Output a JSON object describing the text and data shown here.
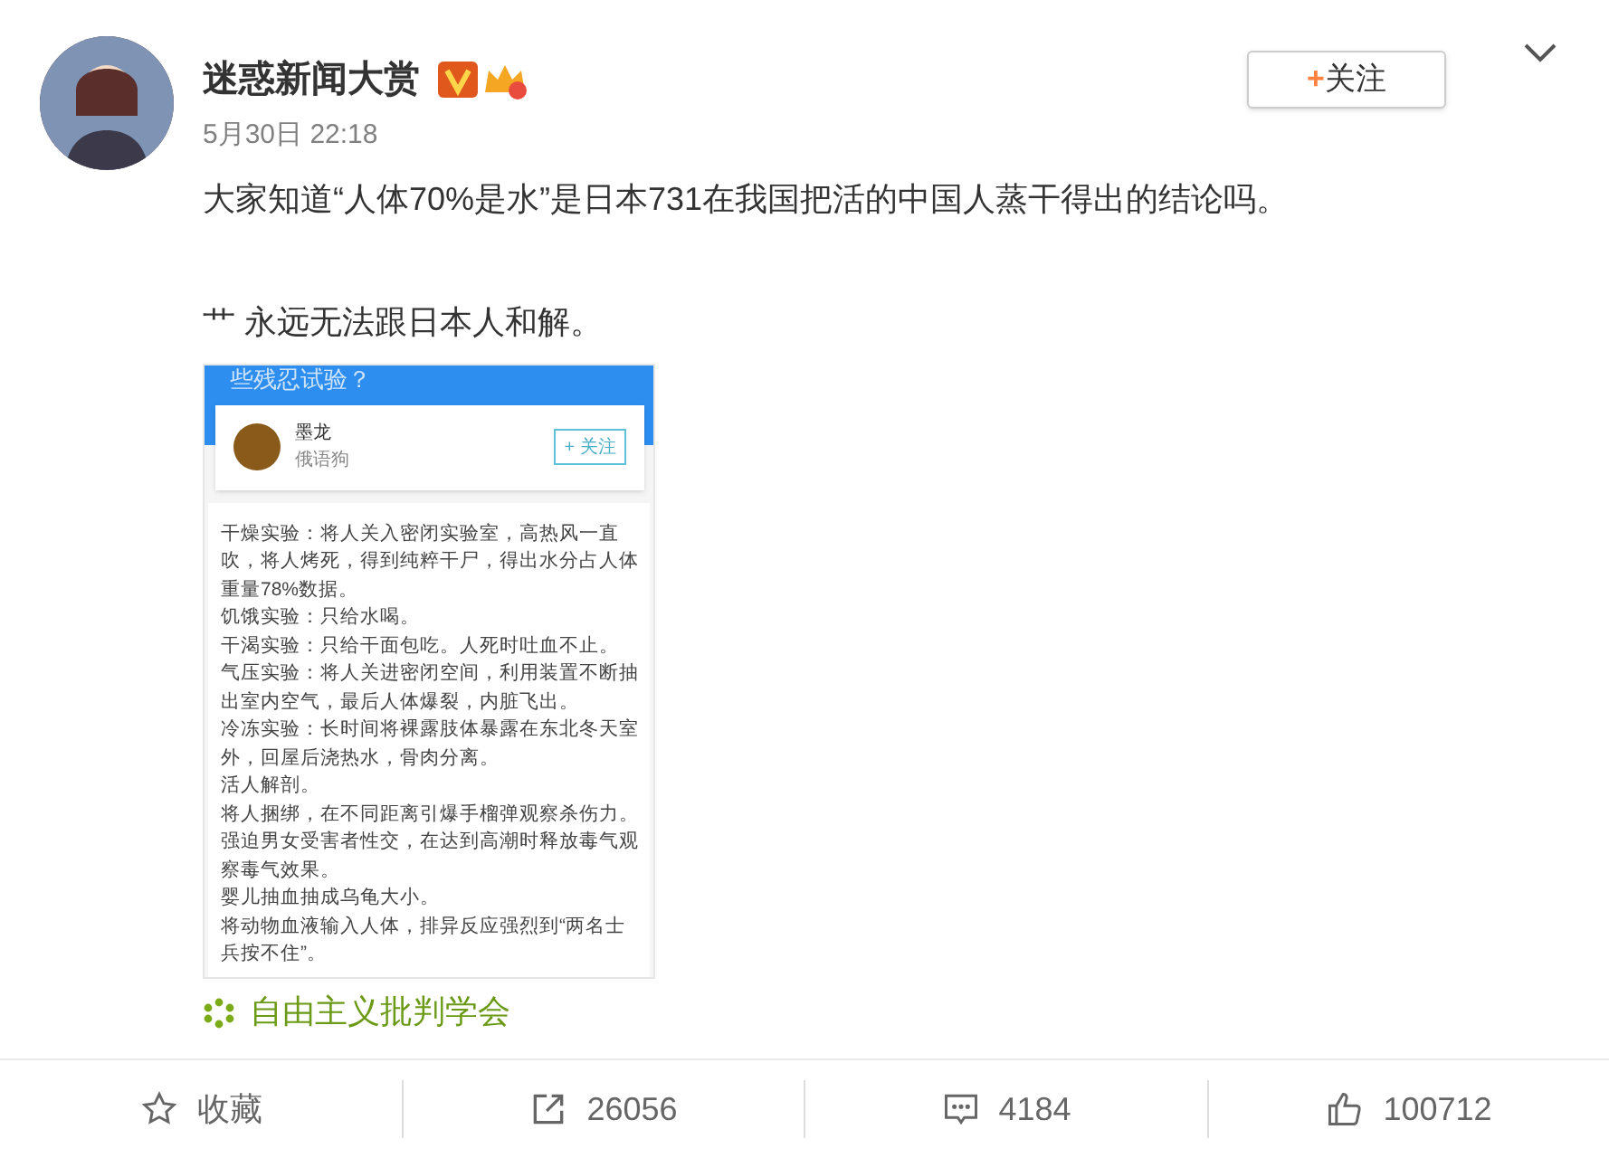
{
  "post": {
    "author": "迷惑新闻大赏",
    "follow_button": "+关注",
    "date": "5月30日 22:18",
    "text_lines": [
      "大家知道“人体70%是水”是日本731在我国把活的中国人蒸干得出的结论吗。",
      "艹 永远无法跟日本人和解。"
    ],
    "embedded_screenshot": {
      "header_text": "些残忍试验？",
      "card": {
        "name": "墨龙",
        "subtitle": "俄语狗",
        "follow_button": "+ 关注"
      },
      "paragraphs": [
        "干燥实验：将人关入密闭实验室，高热风一直吹，将人烤死，得到纯粹干尸，得出水分占人体重量78%数据。",
        "饥饿实验：只给水喝。",
        "干渴实验：只给干面包吃。人死时吐血不止。",
        "气压实验：将人关进密闭空间，利用装置不断抽出室内空气，最后人体爆裂，内脏飞出。",
        "冷冻实验：长时间将裸露肢体暴露在东北冬天室外，回屋后浇热水，骨肉分离。",
        "活人解剖。",
        "将人捆绑，在不同距离引爆手榴弹观察杀伤力。",
        "强迫男女受害者性交，在达到高潮时释放毒气观察毒气效果。",
        "婴儿抽血抽成乌龟大小。",
        "将动物血液输入人体，排异反应强烈到“两名士兵按不住”。"
      ]
    },
    "source": "自由主义批判学会"
  },
  "actions": [
    {
      "kind": "favorite",
      "label": "收藏"
    },
    {
      "kind": "repost",
      "label": "26056"
    },
    {
      "kind": "comment",
      "label": "4184"
    },
    {
      "kind": "like",
      "label": "100712"
    }
  ]
}
